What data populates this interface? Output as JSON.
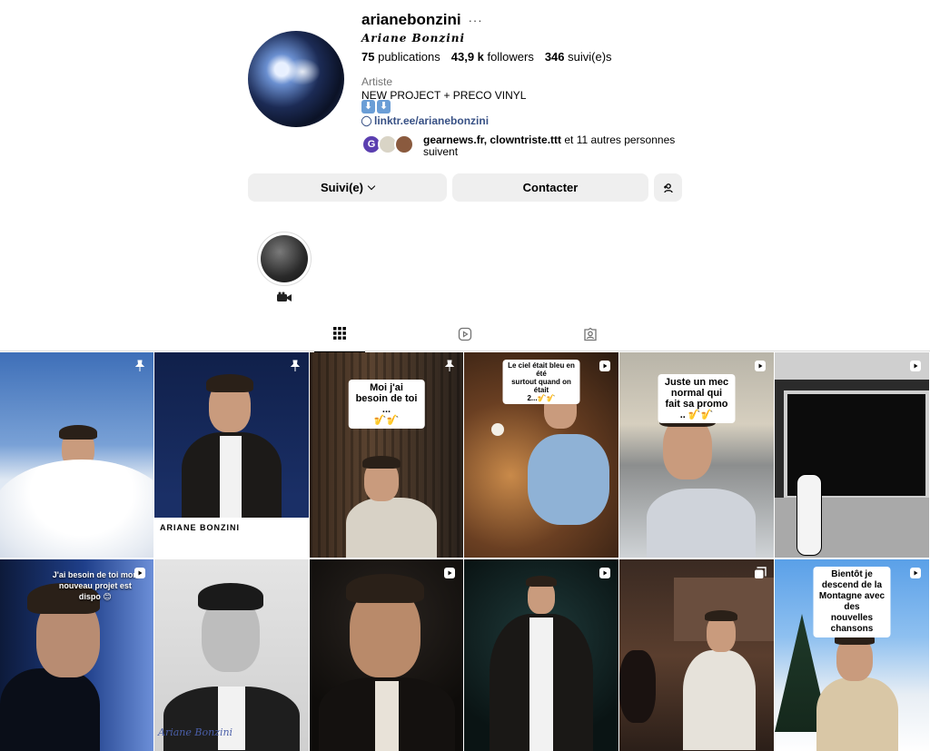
{
  "profile": {
    "username": "arianebonzini",
    "more_label": "···",
    "fullname": "Ariane Bonzini",
    "stats": {
      "posts_count": "75",
      "posts_label": "publications",
      "followers_count": "43,9 k",
      "followers_label": "followers",
      "following_count": "346",
      "following_label": "suivi(e)s"
    },
    "category": "Artiste",
    "bio_line": "NEW PROJECT + PRECO VINYL",
    "bio_arrows": [
      "⬇",
      "⬇"
    ],
    "link": "linktr.ee/arianebonzini",
    "followed_by_names": "gearnews.fr, clowntriste.ttt",
    "followed_by_rest": " et 11 autres personnes suivent",
    "mini_avatar_letter": "G"
  },
  "actions": {
    "follow_label": "Suivi(e)",
    "contact_label": "Contacter"
  },
  "highlights": [
    {
      "icon": "video-camera-icon"
    }
  ],
  "tabs": [
    {
      "icon": "grid-icon",
      "active": true
    },
    {
      "icon": "reels-icon",
      "active": false
    },
    {
      "icon": "tagged-icon",
      "active": false
    }
  ],
  "posts": [
    {
      "badge": "pin-icon",
      "caption": ""
    },
    {
      "badge": "pin-icon",
      "caption": "",
      "name_strip": "ARIANE BONZINI"
    },
    {
      "badge": "pin-icon",
      "caption": "Moi j'ai besoin de toi ...\n🎷🎷"
    },
    {
      "badge": "reel-icon",
      "caption": "Le ciel était bleu en été\nsurtout quand on était\n2...🎷🎷"
    },
    {
      "badge": "reel-icon",
      "caption": "Juste un mec normal qui\nfait sa promo .. 🎷🎷"
    },
    {
      "badge": "reel-icon",
      "caption": ""
    },
    {
      "badge": "reel-icon",
      "caption": "J'ai besoin de toi mon\nnouveau projet est\ndispo 😊"
    },
    {
      "badge": "",
      "caption": "",
      "signature": "Ariane Bonzini"
    },
    {
      "badge": "reel-icon",
      "caption": ""
    },
    {
      "badge": "reel-icon",
      "caption": ""
    },
    {
      "badge": "carousel-icon",
      "caption": ""
    },
    {
      "badge": "reel-icon",
      "caption": "Bientôt je descend de la\nMontagne avec des\nnouvelles chansons"
    }
  ],
  "colors": {
    "link": "#385185",
    "button_bg": "#efefef",
    "divider": "#dbdbdb",
    "muted_text": "#737373"
  }
}
